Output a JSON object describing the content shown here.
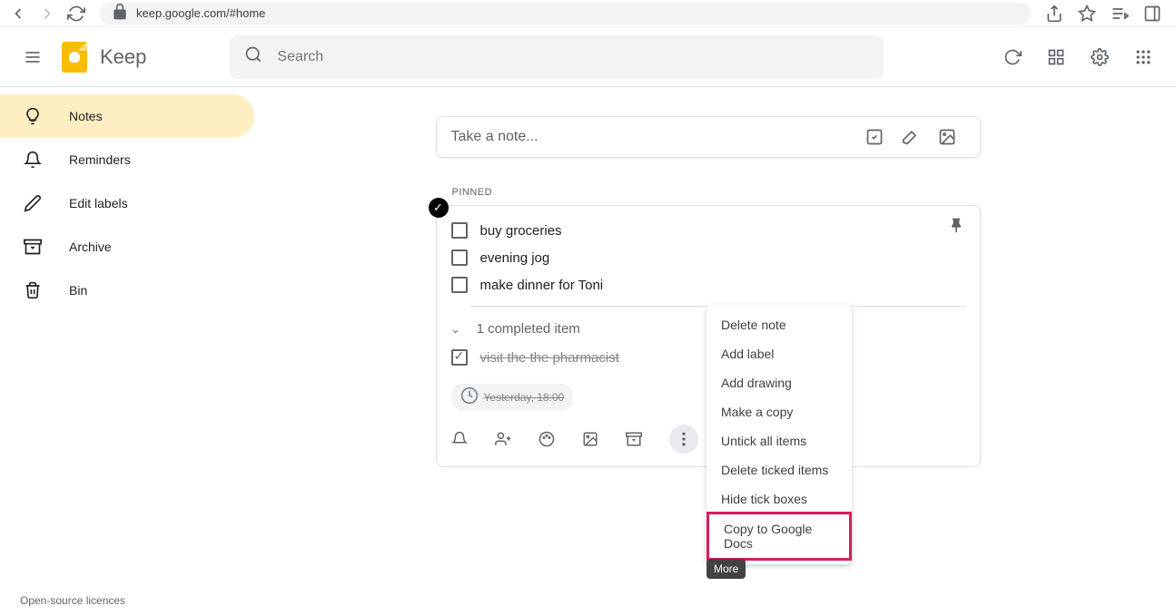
{
  "browser": {
    "url": "keep.google.com/#home"
  },
  "app": {
    "title": "Keep",
    "search_placeholder": "Search"
  },
  "sidebar": {
    "items": [
      {
        "label": "Notes"
      },
      {
        "label": "Reminders"
      },
      {
        "label": "Edit labels"
      },
      {
        "label": "Archive"
      },
      {
        "label": "Bin"
      }
    ],
    "footer": "Open-source licences"
  },
  "take_note": {
    "placeholder": "Take a note..."
  },
  "section": {
    "pinned_label": "PINNED"
  },
  "note": {
    "items": [
      {
        "text": "buy groceries",
        "done": false
      },
      {
        "text": "evening jog",
        "done": false
      },
      {
        "text": "make dinner for Toni",
        "done": false
      }
    ],
    "completed_label": "1 completed item",
    "completed_items": [
      {
        "text": "visit the the pharmacist",
        "done": true
      }
    ],
    "timestamp": "Yesterday, 18:00"
  },
  "menu": {
    "items": [
      "Delete note",
      "Add label",
      "Add drawing",
      "Make a copy",
      "Untick all items",
      "Delete ticked items",
      "Hide tick boxes",
      "Copy to Google Docs"
    ]
  },
  "tooltip": {
    "more": "More"
  }
}
